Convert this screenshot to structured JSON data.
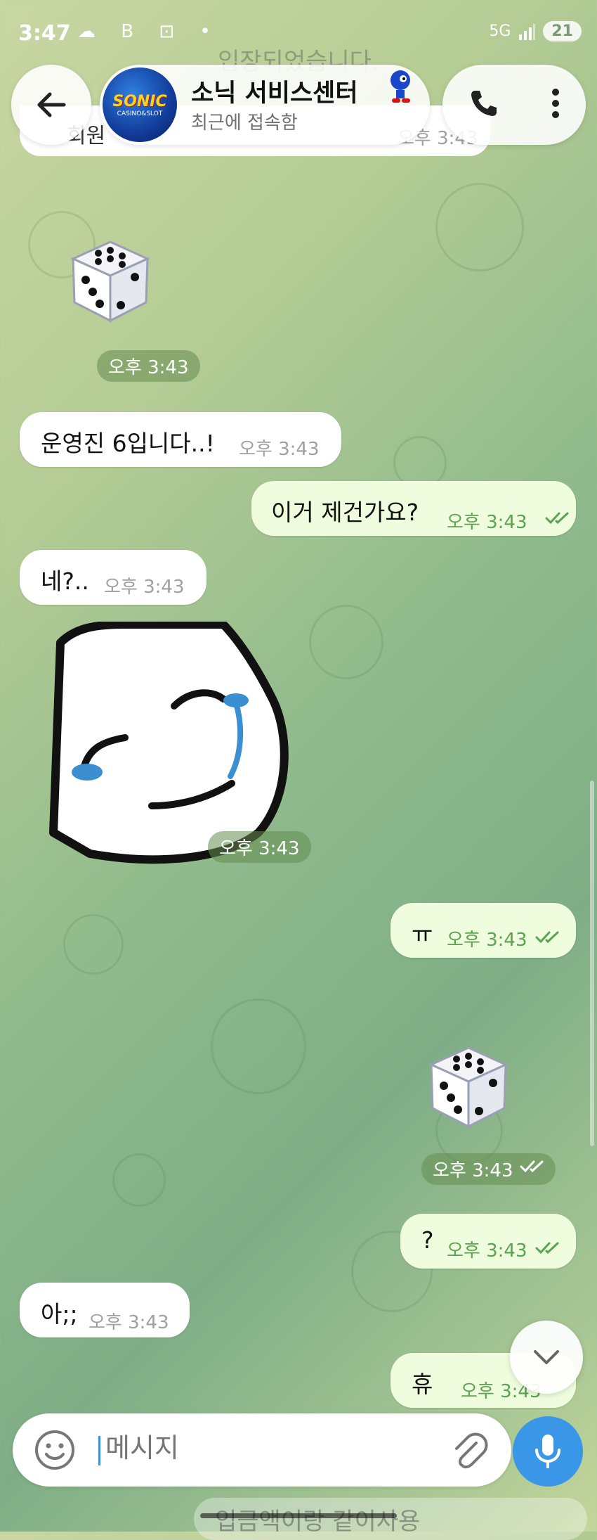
{
  "status_bar": {
    "time": "3:47",
    "left_icons": "☁ B ⊡ •",
    "network": "5G",
    "battery": "21"
  },
  "header": {
    "chat_name": "소닉 서비스센터",
    "last_seen": "최근에 접속함",
    "avatar_main": "SONIC",
    "avatar_sub": "CASINO&SLOT"
  },
  "partial_top": {
    "system_text": "입장되었습니다.",
    "bubble_text": "회원",
    "bubble_time": "오후 3:43"
  },
  "messages": [
    {
      "direction": "in",
      "kind": "dice",
      "time": "오후 3:43"
    },
    {
      "direction": "in",
      "kind": "text",
      "text": "운영진 6입니다..!",
      "time": "오후 3:43"
    },
    {
      "direction": "out",
      "kind": "text",
      "text": "이거 제건가요?",
      "time": "오후 3:43"
    },
    {
      "direction": "in",
      "kind": "text",
      "text": "네?..",
      "time": "오후 3:43"
    },
    {
      "direction": "in",
      "kind": "sticker",
      "time": "오후 3:43"
    },
    {
      "direction": "out",
      "kind": "text",
      "text": "ㅠ",
      "time": "오후 3:43"
    },
    {
      "direction": "out",
      "kind": "dice",
      "time": "오후 3:43"
    },
    {
      "direction": "out",
      "kind": "text",
      "text": "?",
      "time": "오후 3:43"
    },
    {
      "direction": "in",
      "kind": "text",
      "text": "아;;",
      "time": "오후 3:43"
    },
    {
      "direction": "out",
      "kind": "text",
      "text": "휴",
      "time": "오후 3:43"
    }
  ],
  "partial_bottom": {
    "text": "입금액이랑 같이사용"
  },
  "input": {
    "placeholder": "메시지"
  },
  "icons": {
    "back": "arrow-left",
    "call": "phone",
    "menu": "more-vertical",
    "emoji": "smile",
    "attach": "paperclip",
    "mic": "microphone",
    "scroll_down": "chevron-down"
  },
  "colors": {
    "outgoing_bubble": "#effdde",
    "incoming_bubble": "#ffffff",
    "outgoing_time": "#5aa34f",
    "mic_button": "#3a97e8"
  }
}
